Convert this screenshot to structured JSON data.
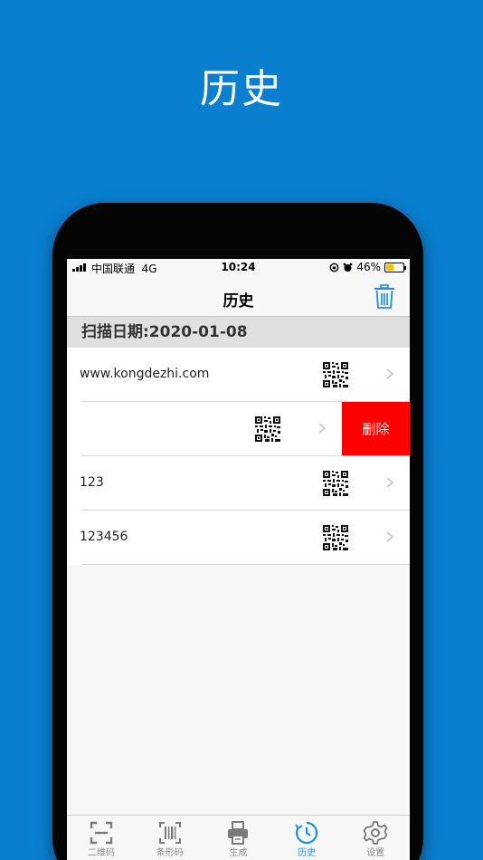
{
  "banner": {
    "title": "历史"
  },
  "status_bar": {
    "carrier": "中国联通",
    "network": "4G",
    "time": "10:24",
    "battery_text": "46%",
    "battery_level": 0.46
  },
  "nav": {
    "title": "历史"
  },
  "section": {
    "header": "扫描日期:2020-01-08"
  },
  "rows": [
    {
      "text": "www.kongdezhi.com"
    },
    {
      "text": ""
    },
    {
      "text": "123"
    },
    {
      "text": "123456"
    }
  ],
  "swipe_action": {
    "delete_label": "删除",
    "color": "#ff0000"
  },
  "tabs": [
    {
      "label": "二维码",
      "icon": "qr-scan-icon"
    },
    {
      "label": "条形码",
      "icon": "barcode-scan-icon"
    },
    {
      "label": "生成",
      "icon": "printer-icon"
    },
    {
      "label": "历史",
      "icon": "history-clock-icon",
      "active": true
    },
    {
      "label": "设置",
      "icon": "gear-icon"
    }
  ],
  "colors": {
    "background": "#0a7fd0",
    "accent": "#1a8ee8"
  }
}
